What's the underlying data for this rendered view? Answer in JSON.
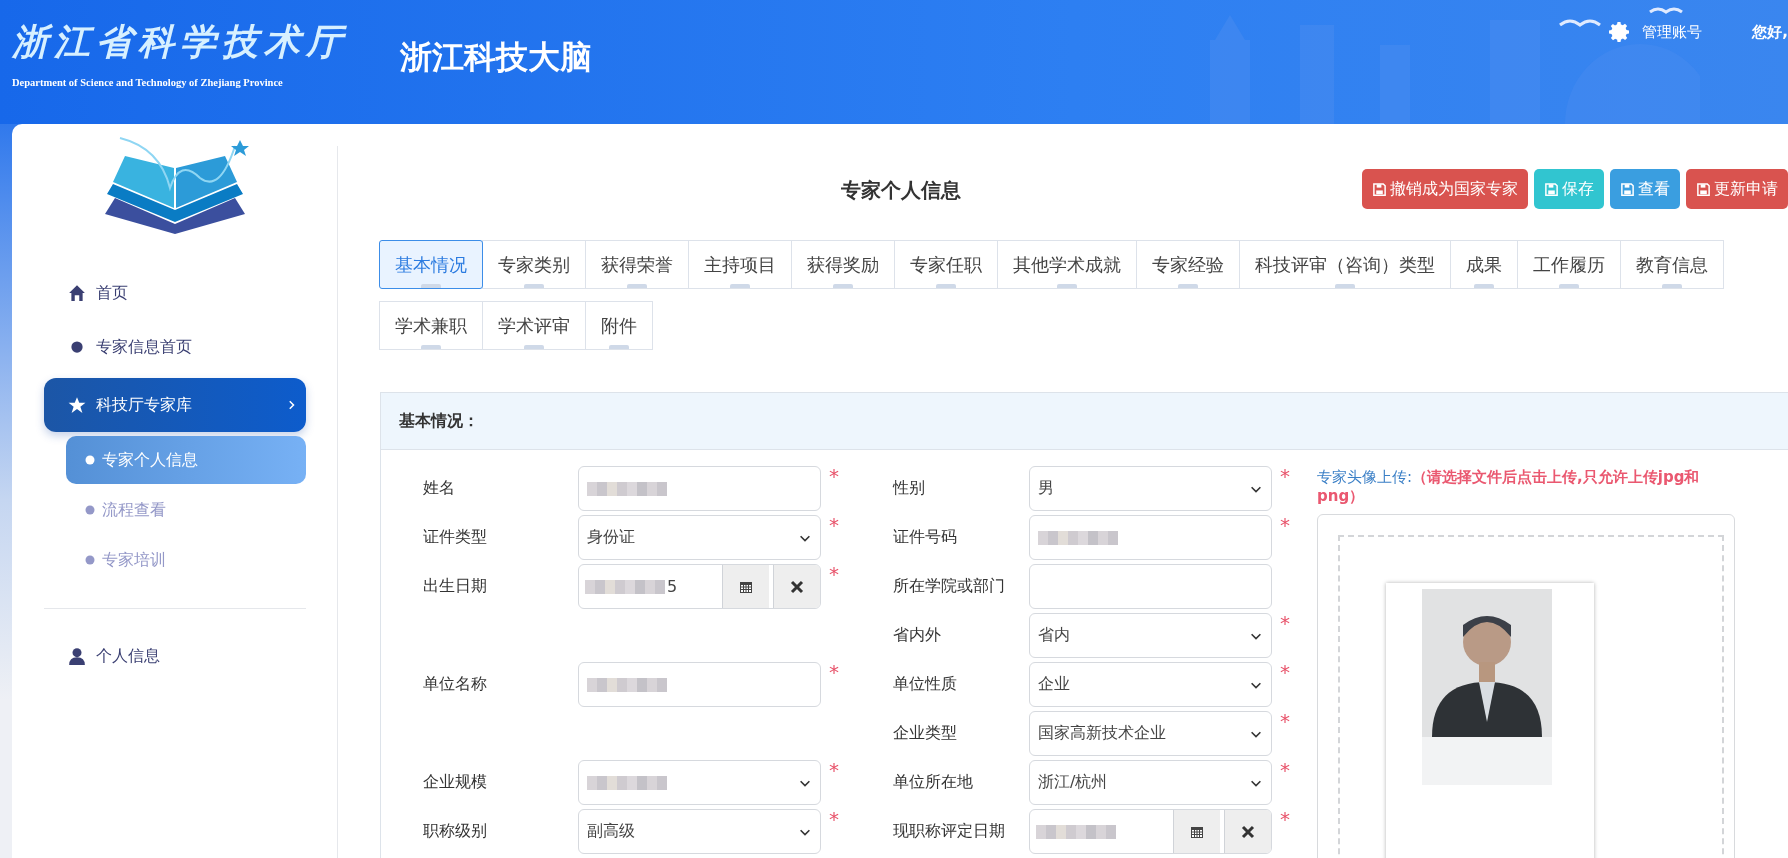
{
  "header": {
    "org_name": "浙江省科学技术厅",
    "org_name_en": "Department of Science and Technology of Zhejiang Province",
    "app_title": "浙江科技大脑",
    "account_link": "管理账号",
    "greeting": "您好,"
  },
  "sidebar": {
    "items": [
      {
        "label": "首页",
        "kind": "home",
        "selected": false
      },
      {
        "label": "专家信息首页",
        "kind": "dot",
        "selected": false
      },
      {
        "label": "科技厅专家库",
        "kind": "star",
        "selected": true,
        "children": [
          {
            "label": "专家个人信息",
            "selected": true
          },
          {
            "label": "流程查看",
            "selected": false
          },
          {
            "label": "专家培训",
            "selected": false
          }
        ]
      },
      {
        "label": "个人信息",
        "kind": "user",
        "selected": false,
        "divider_before": true
      }
    ]
  },
  "page": {
    "title": "专家个人信息",
    "buttons": [
      {
        "label": "撤销成为国家专家",
        "color": "#d9534f"
      },
      {
        "label": "保存",
        "color": "#31c5d0"
      },
      {
        "label": "查看",
        "color": "#3a9ee0"
      },
      {
        "label": "更新申请",
        "color": "#d9534f"
      }
    ],
    "tabs": [
      {
        "label": "基本情况",
        "selected": true
      },
      {
        "label": "专家类别",
        "selected": false
      },
      {
        "label": "获得荣誉",
        "selected": false
      },
      {
        "label": "主持项目",
        "selected": false
      },
      {
        "label": "获得奖励",
        "selected": false
      },
      {
        "label": "专家任职",
        "selected": false
      },
      {
        "label": "其他学术成就",
        "selected": false
      },
      {
        "label": "专家经验",
        "selected": false
      },
      {
        "label": "科技评审（咨询）类型",
        "selected": false
      },
      {
        "label": "成果",
        "selected": false
      },
      {
        "label": "工作履历",
        "selected": false
      },
      {
        "label": "教育信息",
        "selected": false
      },
      {
        "label": "学术兼职",
        "selected": false
      },
      {
        "label": "学术评审",
        "selected": false
      },
      {
        "label": "附件",
        "selected": false
      }
    ]
  },
  "panel": {
    "title": "基本情况：",
    "rows": [
      {
        "left": {
          "label": "姓名",
          "kind": "text",
          "blurred": true,
          "required_mark": "*"
        },
        "right": {
          "label": "性别",
          "kind": "select",
          "value": "男",
          "required_mark": "*"
        }
      },
      {
        "left": {
          "label": "证件类型",
          "kind": "select",
          "value": "身份证",
          "required_mark": "*"
        },
        "right": {
          "label": "证件号码",
          "kind": "text",
          "blurred": true,
          "required_mark": "*"
        }
      },
      {
        "left": {
          "label": "出生日期",
          "kind": "date",
          "blurred": true,
          "value": "5",
          "required_mark": "*"
        },
        "right": {
          "label": "所在学院或部门",
          "kind": "text"
        }
      },
      {
        "right": {
          "label": "省内外",
          "kind": "select",
          "value": "省内",
          "required_mark": "*"
        }
      },
      {
        "left": {
          "label": "单位名称",
          "kind": "text",
          "blurred": true,
          "required_mark": "*"
        },
        "right": {
          "label": "单位性质",
          "kind": "select",
          "value": "企业",
          "required_mark": "*"
        }
      },
      {
        "right": {
          "label": "企业类型",
          "kind": "select",
          "value": "国家高新技术企业",
          "required_mark": "*"
        }
      },
      {
        "left": {
          "label": "企业规模",
          "kind": "select",
          "blurred": true,
          "required_mark": "*"
        },
        "right": {
          "label": "单位所在地",
          "kind": "select",
          "value": "浙江/杭州",
          "required_mark": "*"
        }
      },
      {
        "left": {
          "label": "职称级别",
          "kind": "select",
          "value": "副高级",
          "required_mark": "*"
        },
        "right": {
          "label": "现职称评定日期",
          "kind": "date",
          "blurred": true,
          "required_mark": "*"
        }
      }
    ],
    "upload": {
      "label": "专家头像上传:",
      "hint": "（请选择文件后点击上传,只允许上传jpg和png）"
    }
  }
}
